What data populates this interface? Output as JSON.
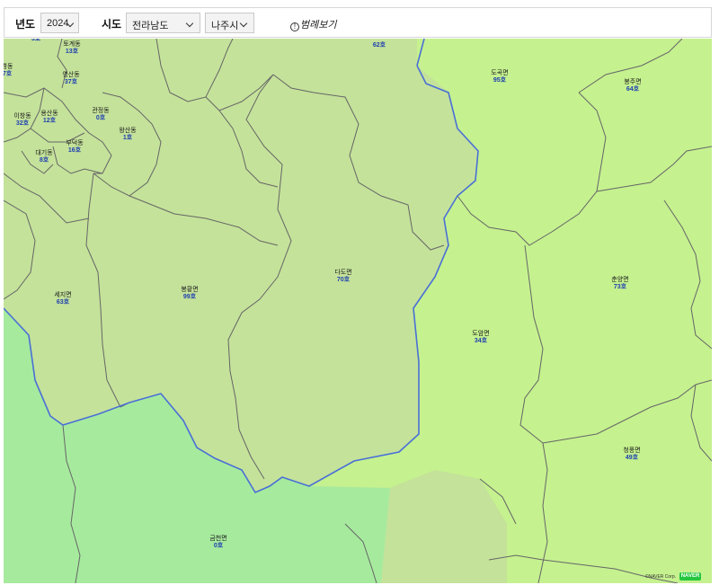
{
  "filters": {
    "year_label": "년도",
    "year_value": "2024",
    "sido_label": "시도",
    "sido_value": "전라남도",
    "sigungu_value": "나주시",
    "legend_label": "범례보기",
    "info_glyph": "!"
  },
  "regions": [
    {
      "name": "토계동",
      "count": "13호"
    },
    {
      "name": "경동",
      "count": "7호"
    },
    {
      "name": "영산동",
      "count": "37호"
    },
    {
      "name": "관정동",
      "count": "0호"
    },
    {
      "name": "이창동",
      "count": "32호"
    },
    {
      "name": "용산동",
      "count": "12호"
    },
    {
      "name": "왕산동",
      "count": "1호"
    },
    {
      "name": "부덕동",
      "count": "16호"
    },
    {
      "name": "대기동",
      "count": "8호"
    },
    {
      "name": "도곡면",
      "count": "95호"
    },
    {
      "name": "봉주면",
      "count": "64호"
    },
    {
      "name": "다도면",
      "count": "70호"
    },
    {
      "name": "세지면",
      "count": "63호"
    },
    {
      "name": "봉황면",
      "count": "99호"
    },
    {
      "name": "춘양면",
      "count": "73호"
    },
    {
      "name": "도암면",
      "count": "34호"
    },
    {
      "name": "청풍면",
      "count": "49호"
    },
    {
      "name": "금천면",
      "count": "0호"
    }
  ],
  "partial_labels": {
    "top_left": "3호",
    "top_center": "62호"
  },
  "map_attribution": "©NAVER Corp.",
  "map_brand": "NAVER",
  "colors": {
    "light_green": "#c4e29a",
    "lime_green": "#c5f18f",
    "mint_green": "#a6ea9e",
    "boundary_blue": "#4a6fd6",
    "boundary_gray": "#666666",
    "count_blue": "#1f3fb0"
  }
}
